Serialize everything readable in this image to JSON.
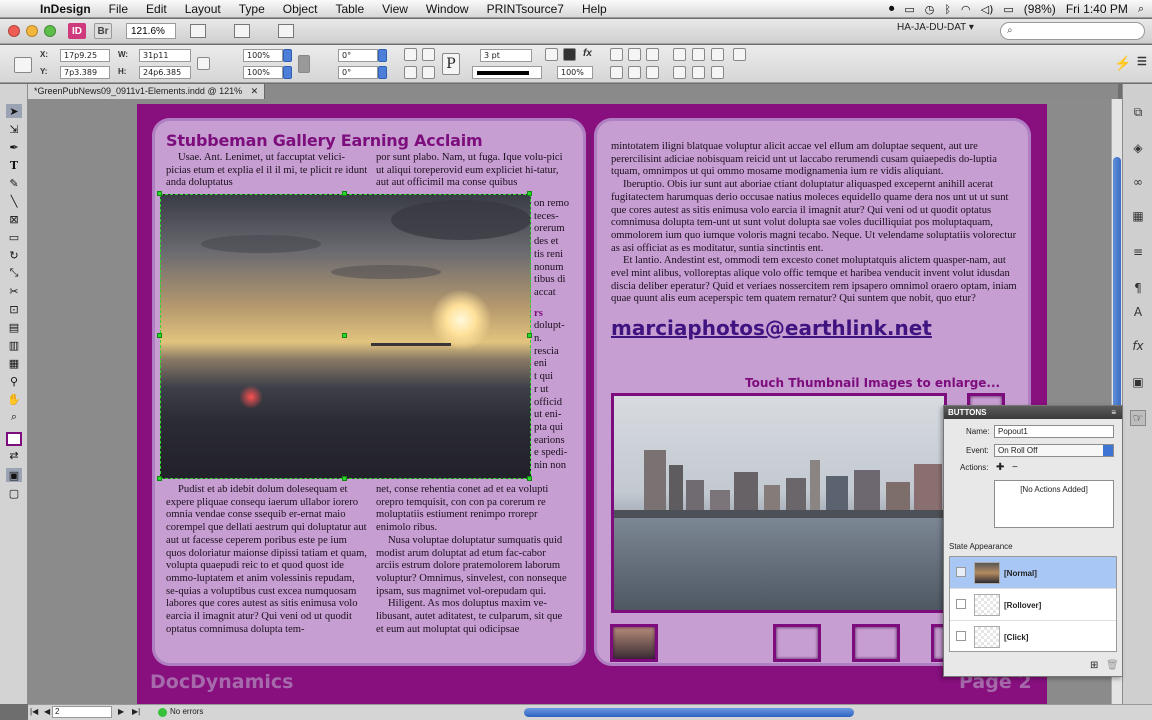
{
  "menubar": {
    "app_name": "InDesign",
    "items": [
      "File",
      "Edit",
      "Layout",
      "Type",
      "Object",
      "Table",
      "View",
      "Window",
      "PRINTsource7",
      "Help"
    ],
    "battery": "(98%)",
    "clock": "Fri 1:40 PM"
  },
  "appbar": {
    "id_badge": "ID",
    "br_badge": "Br",
    "zoom": "121.6%",
    "workspace": "HA-JA-DU-DAT ▾",
    "search_placeholder": "⌕"
  },
  "control": {
    "x_label": "X:",
    "x_value": "17p9.25",
    "y_label": "Y:",
    "y_value": "7p3.389",
    "w_label": "W:",
    "w_value": "31p11",
    "h_label": "H:",
    "h_value": "24p6.385",
    "scale_x": "100%",
    "scale_y": "100%",
    "rotate": "0°",
    "shear": "0°",
    "stroke_weight": "3 pt",
    "opacity": "100%"
  },
  "document_tab": "*GreenPubNews09_0911v1-Elements.indd @ 121%",
  "left_page": {
    "headline": "Stubbeman Gallery Earning Acclaim",
    "col1_top": "Usae. Ant. Lenimet, ut faccuptat velici-picias etum et explia el il il mi, te plicit re idunt anda doluptatus",
    "col2_top": "por sunt plabo. Nam, ut fuga. Ique volu-pici ut aliqui toreperovid eum expliciet hi-tatur, aut aut officimil ma conse quibus",
    "col1_bottom": "Pudist et ab idebit dolum dolesequam et expere pliquae consequ iaerum ullabor iorero omnia vendae conse ssequib er-ernat maio corempel que dellati aestrum qui doluptatur aut aut ut facesse ceperem poribus este pe ium quos doloriatur maionse dipissi tatiam et quam, volupta quaepudi reic to et quod quost ide ommo-luptatem et anim volessinis repudam, se-quias a voluptibus cust excea numquosam labores que cores autest as sitis enimusa volo earcia il imagnit atur? Qui veni od ut quodit optatus comnimusa dolupta tem-",
    "col2_bottom_a": "net, conse rehentia conet ad et ea volupti orepro temquisit, con con pa corerum re moluptatiis estiument renimpo rrorepr enimolo ribus.",
    "col2_bottom_b": "Nusa voluptae doluptatur sumquatis quid modist arum doluptat ad etum fac-cabor arciis estrum dolore pratemolorem laborum voluptur? Omnimus, sinvelest, con nonseque ipsam, sus magnimet vol-orepudam qui.",
    "col2_bottom_c": "Hiligent. As mos doluptus maxim ve-libusant, autet aditatest, te culparum, sit que et eum aut moluptat qui odicipsae",
    "col2_side": [
      "on remo",
      "teces-",
      "orerum",
      "des et",
      "tis reni",
      "nonum",
      "tibus di",
      "accat",
      "rs",
      "dolupt-",
      "n.",
      "rescia",
      "eni",
      "t qui",
      "r ut",
      "officid",
      "ut eni-",
      "pta qui",
      "earions",
      "e spedi-",
      "nin non"
    ],
    "footer": "DocDynamics"
  },
  "right_page": {
    "body_a": "mintotatem iligni blatquae voluptur alicit accae vel ellum am doluptae sequent, aut ure perercilisint adiciae nobisquam reicid unt ut laccabo rerumendi cusam quiaepedis do-luptia tquam, omnimpos ut qui ommo mosame modignamenia ium re vidis aliquiant.",
    "body_b": "Iberuptio. Obis iur sunt aut aboriae ctiant doluptatur aliquasped excepernt anihill acerat fugitatectem harumquas derio occusae natius moleces equidello quame dera nos unt ut ut sunt que cores autest as sitis enimusa volo earcia il imagnit atur? Qui veni od ut quodit optatus comnimusa dolupta tem-unt ut sunt volut dolupta sae voles ducilliquiat pos moluptaquam, ommolorem ium quo iumque voloris magni tecabo. Neque. Ut velendame soluptatiis volorectur as asi officiat as es moditatur, suntia sinctintis ent.",
    "body_c": "Et lantio. Andestint est, ommodi tem excesto conet moluptatquis alictem quasper-nam, aut evel mint alibus, volloreptas alique volo offic temque et haribea venducit invent volut idusdan discia deliber eperatur? Quid et veriaes nossercitem rem ipsapero omnimol oraero optam, iniam quae quunt alis eum aceperspic tem quatem rernatur? Qui suntem que nobit, quo etur?",
    "email": "marciaphotos@earthlink.net",
    "touch_label": "Touch Thumbnail Images to enlarge...",
    "footer": "Page 2"
  },
  "buttons_panel": {
    "title": "BUTTONS",
    "name_label": "Name:",
    "name_value": "Popout1",
    "event_label": "Event:",
    "event_value": "On Roll Off",
    "actions_label": "Actions:",
    "actions_empty": "[No Actions Added]",
    "state_label": "State Appearance",
    "states": [
      "[Normal]",
      "[Rollover]",
      "[Click]"
    ]
  },
  "statusbar": {
    "page": "2",
    "errors": "No errors"
  }
}
